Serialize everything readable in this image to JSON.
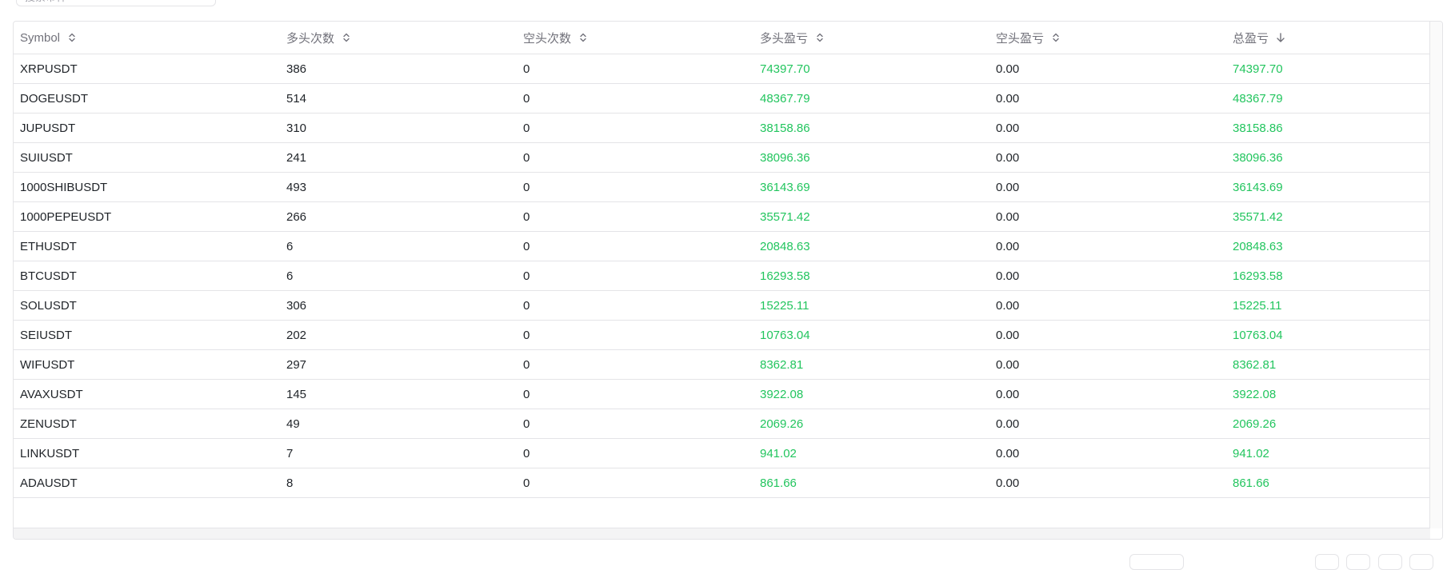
{
  "search": {
    "value": "搜索币种"
  },
  "table": {
    "headers": [
      {
        "label": "Symbol",
        "sort": "none"
      },
      {
        "label": "多头次数",
        "sort": "none"
      },
      {
        "label": "空头次数",
        "sort": "none"
      },
      {
        "label": "多头盈亏",
        "sort": "none"
      },
      {
        "label": "空头盈亏",
        "sort": "none"
      },
      {
        "label": "总盈亏",
        "sort": "desc"
      }
    ],
    "rows": [
      [
        "XRPUSDT",
        "386",
        "0",
        "74397.70",
        "0.00",
        "74397.70"
      ],
      [
        "DOGEUSDT",
        "514",
        "0",
        "48367.79",
        "0.00",
        "48367.79"
      ],
      [
        "JUPUSDT",
        "310",
        "0",
        "38158.86",
        "0.00",
        "38158.86"
      ],
      [
        "SUIUSDT",
        "241",
        "0",
        "38096.36",
        "0.00",
        "38096.36"
      ],
      [
        "1000SHIBUSDT",
        "493",
        "0",
        "36143.69",
        "0.00",
        "36143.69"
      ],
      [
        "1000PEPEUSDT",
        "266",
        "0",
        "35571.42",
        "0.00",
        "35571.42"
      ],
      [
        "ETHUSDT",
        "6",
        "0",
        "20848.63",
        "0.00",
        "20848.63"
      ],
      [
        "BTCUSDT",
        "6",
        "0",
        "16293.58",
        "0.00",
        "16293.58"
      ],
      [
        "SOLUSDT",
        "306",
        "0",
        "15225.11",
        "0.00",
        "15225.11"
      ],
      [
        "SEIUSDT",
        "202",
        "0",
        "10763.04",
        "0.00",
        "10763.04"
      ],
      [
        "WIFUSDT",
        "297",
        "0",
        "8362.81",
        "0.00",
        "8362.81"
      ],
      [
        "AVAXUSDT",
        "145",
        "0",
        "3922.08",
        "0.00",
        "3922.08"
      ],
      [
        "ZENUSDT",
        "49",
        "0",
        "2069.26",
        "0.00",
        "2069.26"
      ],
      [
        "LINKUSDT",
        "7",
        "0",
        "941.02",
        "0.00",
        "941.02"
      ],
      [
        "ADAUSDT",
        "8",
        "0",
        "861.66",
        "0.00",
        "861.66"
      ]
    ]
  },
  "colors": {
    "positive": "#22c55e",
    "header_text": "#71717a",
    "border": "#e4e4e7"
  }
}
